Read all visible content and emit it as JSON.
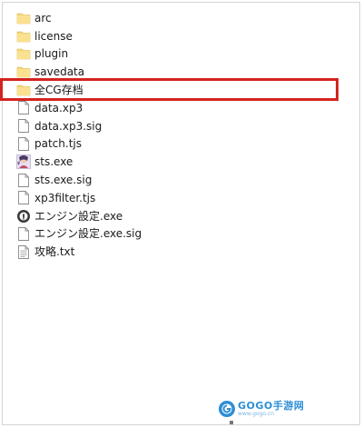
{
  "files": [
    {
      "name": "arc",
      "icon": "folder-icon"
    },
    {
      "name": "license",
      "icon": "folder-icon"
    },
    {
      "name": "plugin",
      "icon": "folder-icon"
    },
    {
      "name": "savedata",
      "icon": "folder-icon"
    },
    {
      "name": "全CG存档",
      "icon": "folder-icon"
    },
    {
      "name": "data.xp3",
      "icon": "document-icon"
    },
    {
      "name": "data.xp3.sig",
      "icon": "document-icon"
    },
    {
      "name": "patch.tjs",
      "icon": "document-icon"
    },
    {
      "name": "sts.exe",
      "icon": "app-icon"
    },
    {
      "name": "sts.exe.sig",
      "icon": "document-icon"
    },
    {
      "name": "xp3filter.tjs",
      "icon": "document-icon"
    },
    {
      "name": "エンジン設定.exe",
      "icon": "settings-exe-icon"
    },
    {
      "name": "エンジン設定.exe.sig",
      "icon": "document-icon"
    },
    {
      "name": "攻略.txt",
      "icon": "text-file-icon"
    }
  ],
  "highlight": {
    "target": "全CG存档",
    "color": "#d42320"
  },
  "watermark": {
    "title": "GOGO手游网",
    "url": "www.gogo.cn"
  },
  "colors": {
    "folder": "#f6d676",
    "accent_blue": "#2d8fd5"
  }
}
